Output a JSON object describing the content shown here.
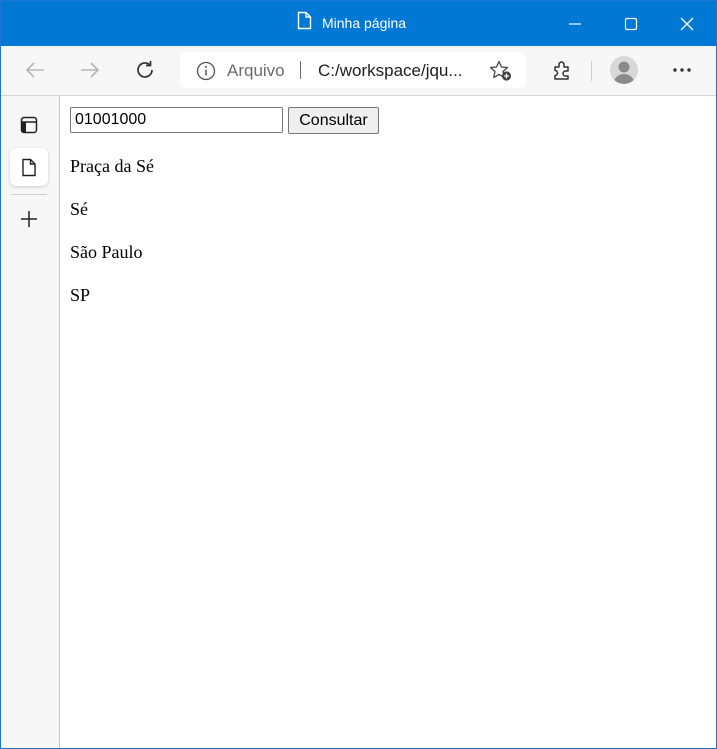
{
  "window": {
    "title": "Minha página"
  },
  "address_bar": {
    "scheme_label": "Arquivo",
    "url": "C:/workspace/jqu..."
  },
  "page": {
    "cep_value": "01001000",
    "button_label": "Consultar",
    "results": {
      "logradouro": "Praça da Sé",
      "bairro": "Sé",
      "localidade": "São Paulo",
      "uf": "SP"
    }
  },
  "theme": {
    "titlebar_color": "#0078d4",
    "toolbar_bg": "#f7f7f7"
  },
  "icons": [
    "page-icon",
    "minimize-icon",
    "maximize-icon",
    "close-icon",
    "back-icon",
    "forward-icon",
    "refresh-icon",
    "info-icon",
    "favorites-add-icon",
    "extensions-icon",
    "profile-avatar",
    "more-icon",
    "tab-actions-icon",
    "vertical-tab-page-icon",
    "new-tab-icon"
  ]
}
